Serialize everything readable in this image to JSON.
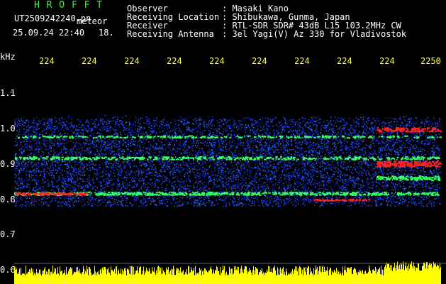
{
  "header": {
    "brand": "H R O F F T",
    "filename": "UT2509242240.pn",
    "meteor_label": "meteor",
    "datetime": "25.09.24 22:40",
    "count": "18.",
    "fields": [
      {
        "key": "Observer",
        "value": ": Masaki Kano"
      },
      {
        "key": "Receiving Location",
        "value": ": Shibukawa, Gunma, Japan"
      },
      {
        "key": "Receiver",
        "value": ": RTL-SDR SDR# 43dB L15 103.2MHz CW"
      },
      {
        "key": "Receiving Antenna",
        "value": ": 3el Yagi(V) Az 330 for Vladivostok"
      }
    ]
  },
  "axis": {
    "unit": "kHz",
    "y_ticks": [
      "1.1",
      "1.0",
      "0.9",
      "0.8",
      "0.7",
      "0.6"
    ],
    "x_ticks": [
      "224",
      "224",
      "224",
      "224",
      "224",
      "224",
      "224",
      "224",
      "224",
      "2250"
    ]
  },
  "colors": {
    "background": "#000000",
    "noise_blue": "#1a3aff",
    "signal_green": "#33ff66",
    "signal_red": "#ff2222",
    "bars_yellow": "#ffff00"
  }
}
